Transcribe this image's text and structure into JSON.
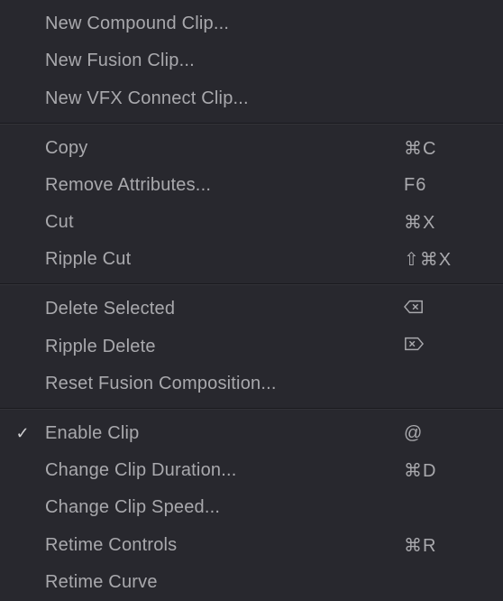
{
  "menu": {
    "sections": [
      {
        "items": [
          {
            "id": "new-compound-clip",
            "label": "New Compound Clip...",
            "shortcut": "",
            "checked": false,
            "iconShortcut": null
          },
          {
            "id": "new-fusion-clip",
            "label": "New Fusion Clip...",
            "shortcut": "",
            "checked": false,
            "iconShortcut": null
          },
          {
            "id": "new-vfx-connect",
            "label": "New VFX Connect Clip...",
            "shortcut": "",
            "checked": false,
            "iconShortcut": null
          }
        ]
      },
      {
        "items": [
          {
            "id": "copy",
            "label": "Copy",
            "shortcut": "⌘C",
            "checked": false,
            "iconShortcut": null
          },
          {
            "id": "remove-attributes",
            "label": "Remove Attributes...",
            "shortcut": "F6",
            "checked": false,
            "iconShortcut": null
          },
          {
            "id": "cut",
            "label": "Cut",
            "shortcut": "⌘X",
            "checked": false,
            "iconShortcut": null
          },
          {
            "id": "ripple-cut",
            "label": "Ripple Cut",
            "shortcut": "⇧⌘X",
            "checked": false,
            "iconShortcut": null
          }
        ]
      },
      {
        "items": [
          {
            "id": "delete-selected",
            "label": "Delete Selected",
            "shortcut": "",
            "checked": false,
            "iconShortcut": "delete-left"
          },
          {
            "id": "ripple-delete",
            "label": "Ripple Delete",
            "shortcut": "",
            "checked": false,
            "iconShortcut": "delete-right"
          },
          {
            "id": "reset-fusion-comp",
            "label": "Reset Fusion Composition...",
            "shortcut": "",
            "checked": false,
            "iconShortcut": null
          }
        ]
      },
      {
        "items": [
          {
            "id": "enable-clip",
            "label": "Enable Clip",
            "shortcut": "@",
            "checked": true,
            "iconShortcut": null
          },
          {
            "id": "change-duration",
            "label": "Change Clip Duration...",
            "shortcut": "⌘D",
            "checked": false,
            "iconShortcut": null
          },
          {
            "id": "change-speed",
            "label": "Change Clip Speed...",
            "shortcut": "",
            "checked": false,
            "iconShortcut": null
          },
          {
            "id": "retime-controls",
            "label": "Retime Controls",
            "shortcut": "⌘R",
            "checked": false,
            "iconShortcut": null
          },
          {
            "id": "retime-curve",
            "label": "Retime Curve",
            "shortcut": "",
            "checked": false,
            "iconShortcut": null
          }
        ]
      }
    ]
  }
}
